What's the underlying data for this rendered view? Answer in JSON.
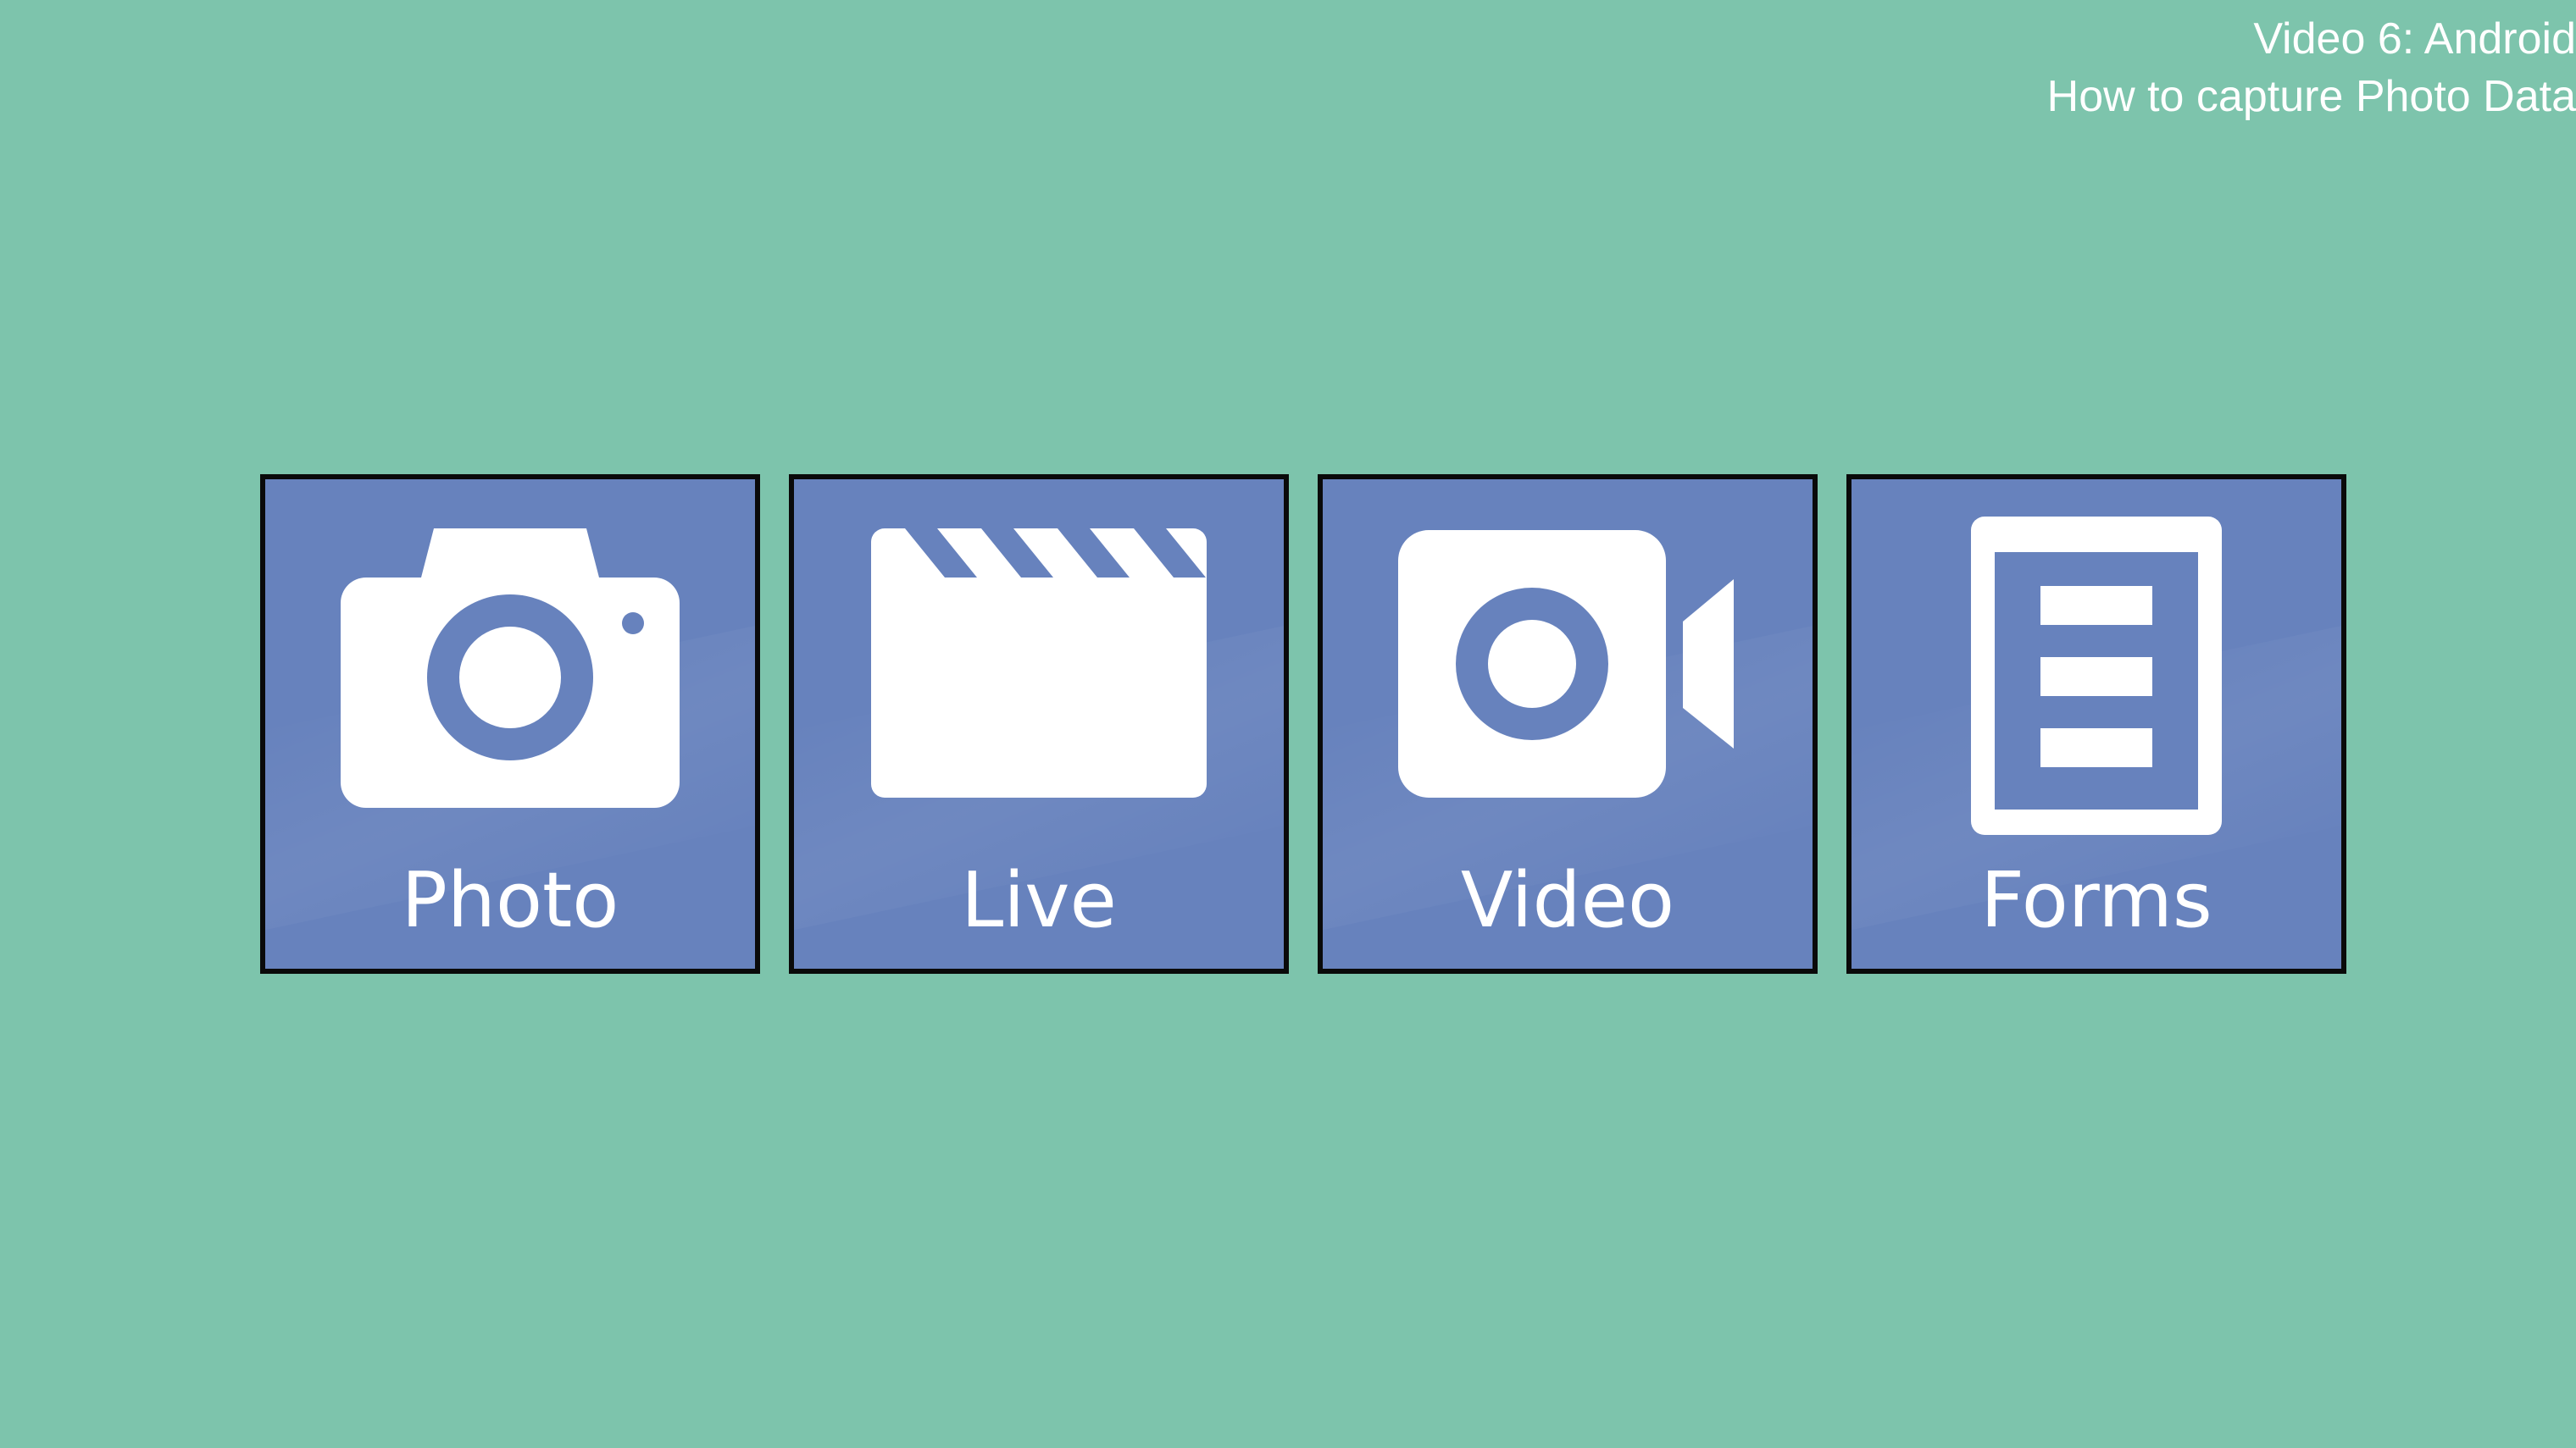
{
  "caption": {
    "line1": "Video 6: Android",
    "line2": "How to capture Photo Data"
  },
  "tiles": [
    {
      "label": "Photo",
      "icon": "camera-icon"
    },
    {
      "label": "Live",
      "icon": "clapperboard-icon"
    },
    {
      "label": "Video",
      "icon": "video-camera-icon"
    },
    {
      "label": "Forms",
      "icon": "form-document-icon"
    }
  ],
  "colors": {
    "background": "#7dc4ac",
    "tile": "#6782bd",
    "tile_border": "#0a0a0a",
    "icon": "#ffffff"
  }
}
